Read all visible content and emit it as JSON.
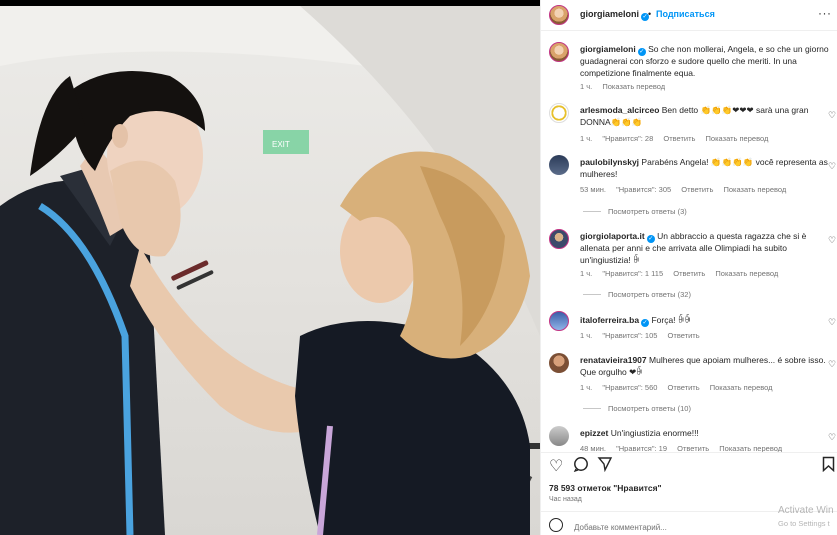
{
  "header": {
    "username": "giorgiameloni",
    "separator": "•",
    "follow_label": "Подписаться",
    "more_label": "···"
  },
  "caption": {
    "username": "giorgiameloni",
    "text": "So che non mollerai, Angela, e so che un giorno guadagnerai con sforzo e sudore quello che meriti. In una competizione finalmente equa.",
    "time": "1 ч.",
    "translate": "Показать перевод"
  },
  "comments": [
    {
      "username": "arlesmoda_alcirceo",
      "text": "Ben detto 👏👏👏❤❤❤ sarà una gran DONNA👏👏👏",
      "time": "1 ч.",
      "likes": "\"Нравится\": 28",
      "reply": "Ответить",
      "translate": "Показать перевод"
    },
    {
      "username": "paulobilynskyj",
      "text": "Parabéns Angela! 👏👏👏👏 você representa as mulheres!",
      "time": "53 мин.",
      "likes": "\"Нравится\": 305",
      "reply": "Ответить",
      "translate": "Показать перевод",
      "replies": "Посмотреть ответы (3)"
    },
    {
      "username": "giorgiolaporta.it",
      "text": "Un abbraccio a questa ragazza che si è allenata per anni e che arrivata alle Olimpiadi ha subito un'ingiustizia! ꀼ",
      "time": "1 ч.",
      "likes": "\"Нравится\": 1 115",
      "reply": "Ответить",
      "translate": "Показать перевод",
      "replies": "Посмотреть ответы (32)"
    },
    {
      "username": "italoferreira.ba",
      "text": "Força! ꀼꀼ",
      "time": "1 ч.",
      "likes": "\"Нравится\": 105",
      "reply": "Ответить"
    },
    {
      "username": "renatavieira1907",
      "text": "Mulheres que apoiam mulheres... é sobre isso. Que orgulho ❤ꀼ",
      "time": "1 ч.",
      "likes": "\"Нравится\": 560",
      "reply": "Ответить",
      "translate": "Показать перевод",
      "replies": "Посмотреть ответы (10)"
    },
    {
      "username": "epizzet",
      "text": "Un'ingiustizia enorme!!!",
      "time": "48 мин.",
      "likes": "\"Нравится\": 19",
      "reply": "Ответить",
      "translate": "Показать перевод"
    }
  ],
  "footer": {
    "likes_count": "78 593 отметок \"Нравится\"",
    "time": "Час назад",
    "add_comment_placeholder": "Добавьте комментарий..."
  },
  "watermark": {
    "line1": "Activate Win",
    "line2": "Go to Settings t"
  },
  "photo": {
    "sign_text": "EXIT"
  },
  "colors": {
    "accent": "#0095f6",
    "text": "#262626",
    "muted": "#737373",
    "divider": "#efefef"
  }
}
